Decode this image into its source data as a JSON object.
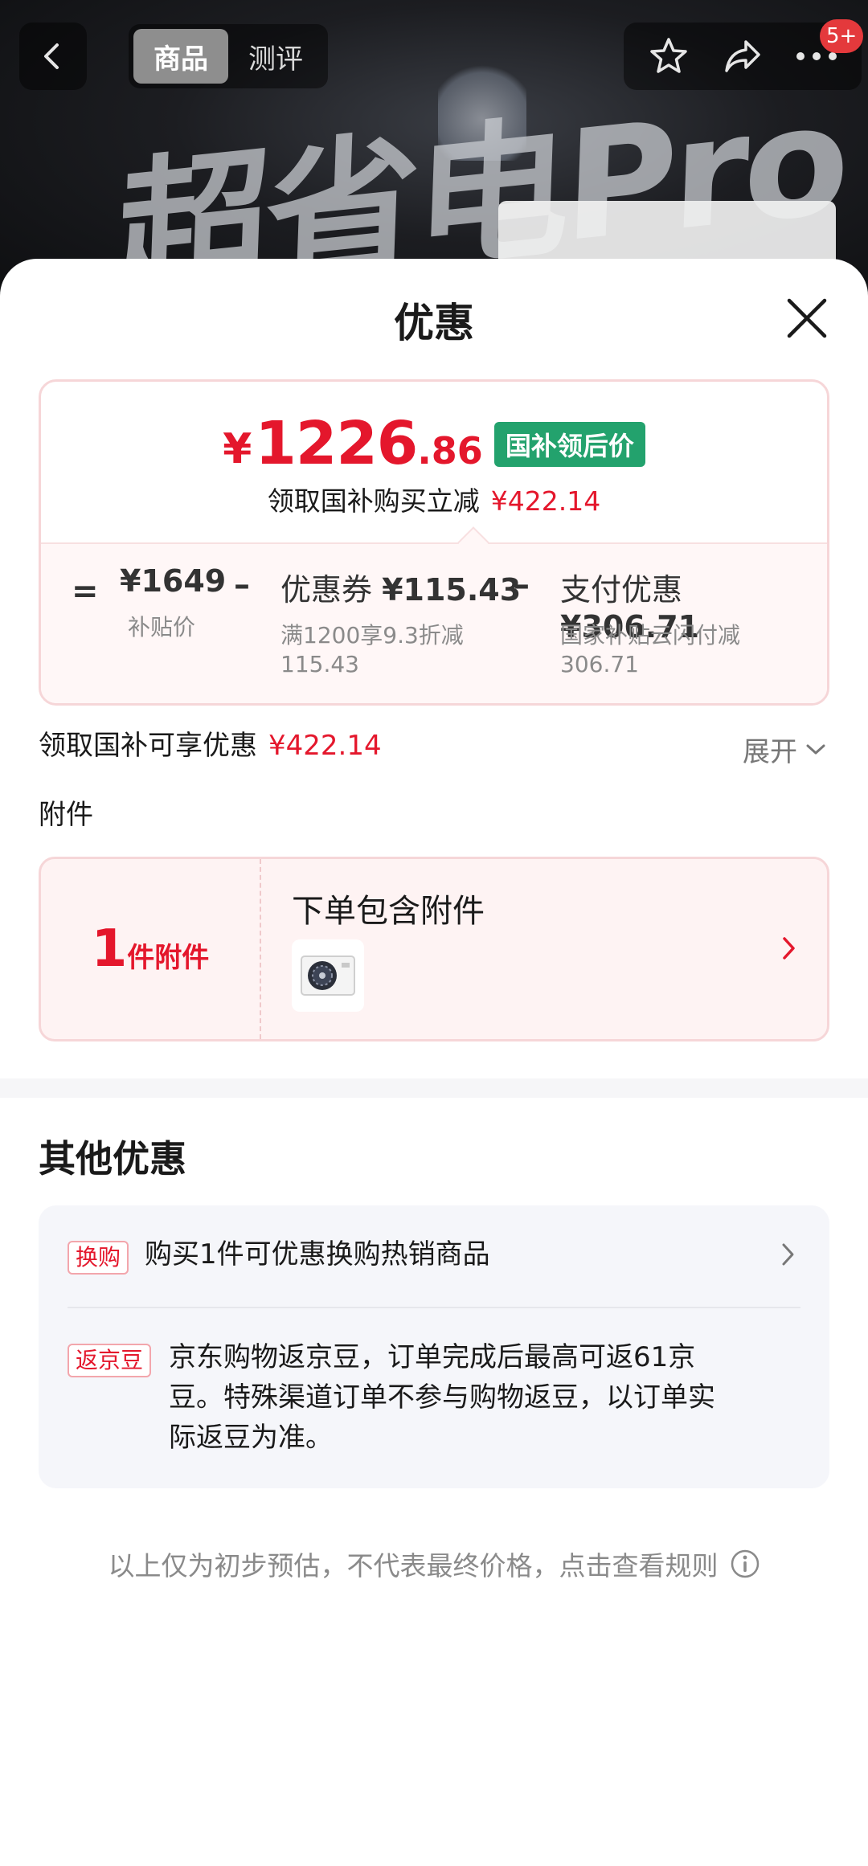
{
  "hero": {
    "banner_text": "超省电Pro"
  },
  "topbar": {
    "tabs": [
      {
        "label": "商品",
        "active": true
      },
      {
        "label": "测评",
        "active": false
      }
    ],
    "badge": "5+"
  },
  "sheet": {
    "title": "优惠",
    "final_price": {
      "currency": "¥",
      "integer": "1226",
      "decimal": ".86",
      "tag": "国补领后价"
    },
    "save_line": {
      "label": "领取国补购买立减",
      "amount": "¥422.14"
    },
    "calc": {
      "equals": "=",
      "minus": "–",
      "base": {
        "value": "¥1649",
        "label": "补贴价"
      },
      "coupon": {
        "label": "优惠券",
        "value": "¥115.43",
        "desc_line1": "满1200享9.3折减",
        "desc_line2": "115.43"
      },
      "payment": {
        "label": "支付优惠",
        "value": "¥306.71",
        "desc_line1": "国家补贴云闪付减",
        "desc_line2": "306.71"
      }
    },
    "discount": {
      "label": "领取国补可享优惠",
      "amount": "¥422.14",
      "expand_label": "展开"
    },
    "accessory": {
      "section_label": "附件",
      "count": "1",
      "unit": "件附件",
      "title": "下单包含附件"
    },
    "other": {
      "title": "其他优惠",
      "items": [
        {
          "tag": "换购",
          "text": "购买1件可优惠换购热销商品"
        },
        {
          "tag": "返京豆",
          "line1": "京东购物返京豆，订单完成后最高可返61京",
          "line2": "豆。特殊渠道订单不参与购物返豆，以订单实",
          "line3": "际返豆为准。"
        }
      ]
    },
    "footer_note": "以上仅为初步预估，不代表最终价格，点击查看规则"
  },
  "colors": {
    "accent_red": "#e4172c",
    "gov_green": "#23a26d",
    "badge_red": "#e4393c"
  }
}
